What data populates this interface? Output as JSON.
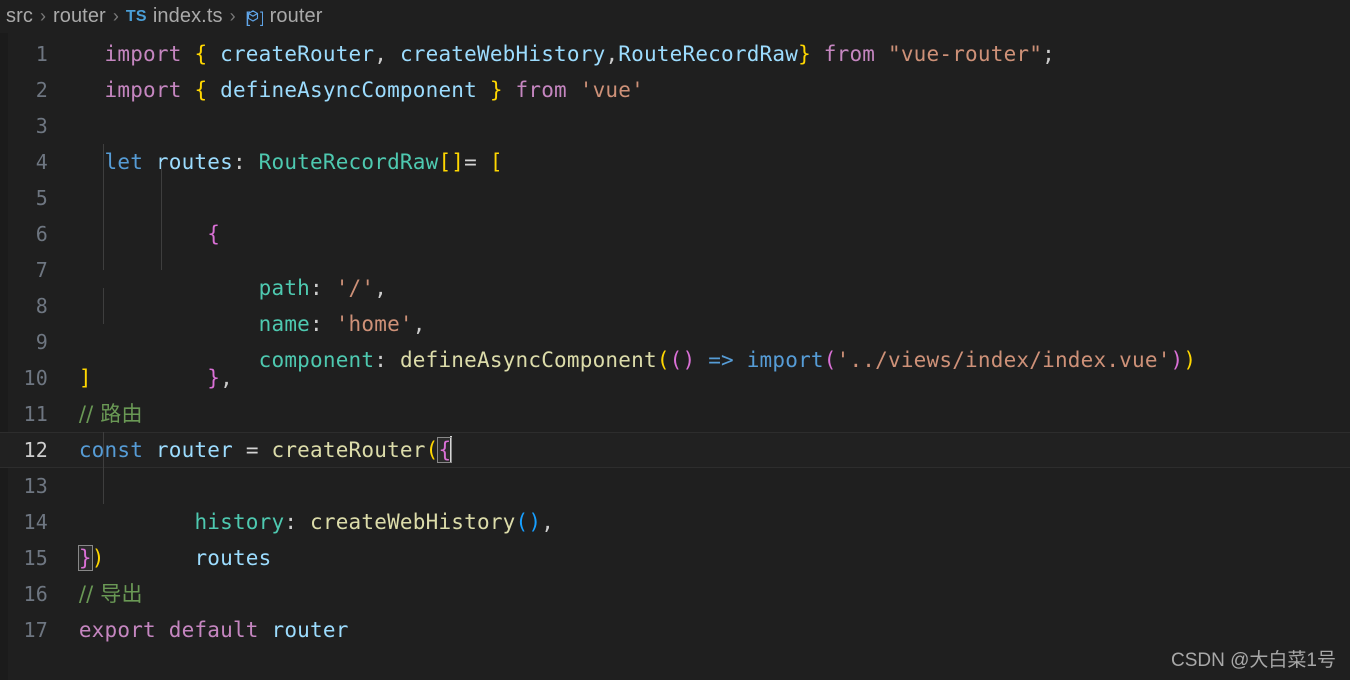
{
  "breadcrumb": {
    "parts": [
      {
        "label": "src",
        "kind": "folder"
      },
      {
        "label": "router",
        "kind": "folder"
      },
      {
        "label": "index.ts",
        "kind": "file",
        "icon_label": "TS",
        "icon_name": "typescript-file-icon"
      },
      {
        "label": "router",
        "kind": "symbol",
        "icon_name": "symbol-variable-icon"
      }
    ],
    "separator": "›"
  },
  "editor": {
    "language": "typescript",
    "active_line": 12,
    "cursor_line": 12,
    "cursor_column": 25,
    "lines": [
      {
        "n": 1,
        "text": "import { createRouter, createWebHistory,RouteRecordRaw} from \"vue-router\";"
      },
      {
        "n": 2,
        "text": "import { defineAsyncComponent } from 'vue'"
      },
      {
        "n": 3,
        "text": ""
      },
      {
        "n": 4,
        "text": "let routes: RouteRecordRaw[]= ["
      },
      {
        "n": 5,
        "text": "    {"
      },
      {
        "n": 6,
        "text": "        path: '/',"
      },
      {
        "n": 7,
        "text": "        name: 'home',"
      },
      {
        "n": 8,
        "text": "        component: defineAsyncComponent(() => import('../views/index/index.vue'))"
      },
      {
        "n": 9,
        "text": "    },"
      },
      {
        "n": 10,
        "text": "]"
      },
      {
        "n": 11,
        "text": "// 路由"
      },
      {
        "n": 12,
        "text": "const router = createRouter({"
      },
      {
        "n": 13,
        "text": "   history: createWebHistory(),"
      },
      {
        "n": 14,
        "text": "   routes"
      },
      {
        "n": 15,
        "text": "})"
      },
      {
        "n": 16,
        "text": "// 导出"
      },
      {
        "n": 17,
        "text": "export default router"
      }
    ],
    "tokens": {
      "l1": {
        "import": "import",
        "brace_open": "{",
        "name1": "createRouter",
        "comma1": ",",
        "name2": "createWebHistory",
        "comma2": ",",
        "name3": "RouteRecordRaw",
        "brace_close": "}",
        "from": "from",
        "module": "\"vue-router\"",
        "semi": ";"
      },
      "l2": {
        "import": "import",
        "brace_open": "{",
        "name1": "defineAsyncComponent",
        "brace_close": "}",
        "from": "from",
        "module": "'vue'"
      },
      "l4": {
        "let": "let",
        "name": "routes",
        "colon": ":",
        "type": "RouteRecordRaw",
        "arr": "[]",
        "eq": "=",
        "bracket": "["
      },
      "l5": {
        "brace": "{"
      },
      "l6": {
        "key": "path",
        "colon": ":",
        "value": "'/'",
        "comma": ","
      },
      "l7": {
        "key": "name",
        "colon": ":",
        "value": "'home'",
        "comma": ","
      },
      "l8": {
        "key": "component",
        "colon": ":",
        "fn": "defineAsyncComponent",
        "paren1": "(",
        "paren2": "()",
        "arrow": "=>",
        "import": "import",
        "paren3": "(",
        "module": "'../views/index/index.vue'",
        "paren4": ")",
        "paren5": ")"
      },
      "l9": {
        "brace": "}",
        "comma": ","
      },
      "l10": {
        "bracket": "]"
      },
      "l11": {
        "comment": "// 路由"
      },
      "l12": {
        "const": "const",
        "name": "router",
        "eq": "=",
        "fn": "createRouter",
        "paren": "(",
        "brace": "{"
      },
      "l13": {
        "key": "history",
        "colon": ":",
        "fn": "createWebHistory",
        "parens": "()",
        "comma": ","
      },
      "l14": {
        "name": "routes"
      },
      "l15": {
        "brace": "}",
        "paren": ")"
      },
      "l16": {
        "comment": "// 导出"
      },
      "l17": {
        "export": "export",
        "default": "default",
        "name": "router"
      }
    }
  },
  "watermark": {
    "text": "CSDN @大白菜1号"
  },
  "colors": {
    "background": "#1f1f1f",
    "active_line": "#212121",
    "gutter_text": "#6e7681",
    "keyword": "#c586c0",
    "keyword_control": "#569cd6",
    "identifier": "#9cdcfe",
    "function": "#dcdcaa",
    "type": "#4ec9b0",
    "string": "#ce9178",
    "comment": "#6a9955",
    "bracket_yellow": "#ffd700",
    "bracket_magenta": "#da70d6",
    "bracket_blue": "#179fff",
    "accent_blue": "#4a9fd8"
  }
}
